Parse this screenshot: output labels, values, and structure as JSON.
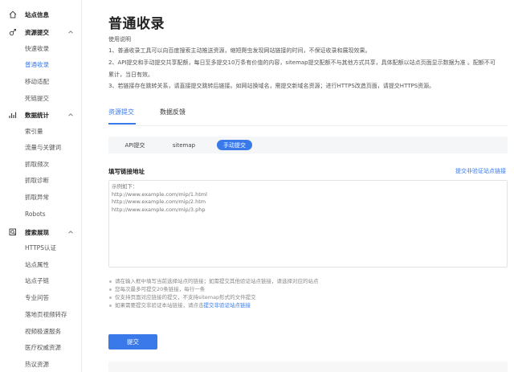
{
  "sidebar": {
    "sections": [
      {
        "label": "站点信息",
        "icon": "home-icon",
        "expandable": false,
        "items": []
      },
      {
        "label": "资源提交",
        "icon": "link-icon",
        "expandable": true,
        "items": [
          {
            "label": "快速收录",
            "active": false
          },
          {
            "label": "普通收录",
            "active": true
          },
          {
            "label": "移动适配",
            "active": false
          },
          {
            "label": "死链提交",
            "active": false
          }
        ]
      },
      {
        "label": "数据统计",
        "icon": "chart-icon",
        "expandable": true,
        "items": [
          {
            "label": "索引量",
            "active": false
          },
          {
            "label": "流量与关键词",
            "active": false
          },
          {
            "label": "抓取频次",
            "active": false
          },
          {
            "label": "抓取诊断",
            "active": false
          },
          {
            "label": "抓取异常",
            "active": false
          },
          {
            "label": "Robots",
            "active": false
          }
        ]
      },
      {
        "label": "搜索展现",
        "icon": "search-display-icon",
        "expandable": true,
        "items": [
          {
            "label": "HTTPS认证",
            "active": false
          },
          {
            "label": "站点属性",
            "active": false
          },
          {
            "label": "站点子链",
            "active": false
          },
          {
            "label": "专业问答",
            "active": false
          },
          {
            "label": "落地页视频转存",
            "active": false
          },
          {
            "label": "视频极速服务",
            "active": false
          },
          {
            "label": "医疗权威资源",
            "active": false
          },
          {
            "label": "热议资源",
            "active": false
          }
        ]
      }
    ]
  },
  "main": {
    "title": "普通收录",
    "usage": {
      "title": "使用说明",
      "lines": [
        "1、普通收录工具可以向百度搜索主动推送资源，缩短爬虫发现网站链接的时间，不保证收录和展现效果。",
        "2、API提交和手动提交共享配额，每日至多提交10万条有价值的内容，sitemap提交配额不与其他方式共享，具体配额以站点页面显示数据为准 。配额不可",
        "累计，当日有效。",
        "3、若链接存在跳转关系，请直接提交跳转后链接。如网站换域名，需提交新域名资源；进行HTTPS改造页面，请提交HTTPS资源。"
      ]
    },
    "tabs": [
      {
        "label": "资源提交",
        "active": true
      },
      {
        "label": "数据反馈",
        "active": false
      }
    ],
    "subtabs": [
      {
        "label": "API提交",
        "active": false
      },
      {
        "label": "sitemap",
        "active": false
      },
      {
        "label": "手动提交",
        "active": true
      }
    ],
    "form": {
      "label": "填写链接地址",
      "right_link": "提交非验证站点链接",
      "placeholder": "示例如下：\nhttp://www.example.com/mip/1.html\nhttp://www.example.com/mip/2.htm\nhttp://www.example.com/mip/3.php",
      "tips": [
        "请在输入框中填写当前选择站点的链接；如需提交其他验证站点链接，请选择对应的站点",
        "您每次最多可提交20条链接，每行一条",
        "仅支持页面对应链接的提交，不支持sitemap形式的文件提交"
      ],
      "tip_last_prefix": "如果需要提交非验证本站链接，请点击",
      "tip_last_link": "提交非验证站点链接",
      "submit_label": "提交"
    }
  },
  "colors": {
    "accent": "#3a79e9"
  }
}
